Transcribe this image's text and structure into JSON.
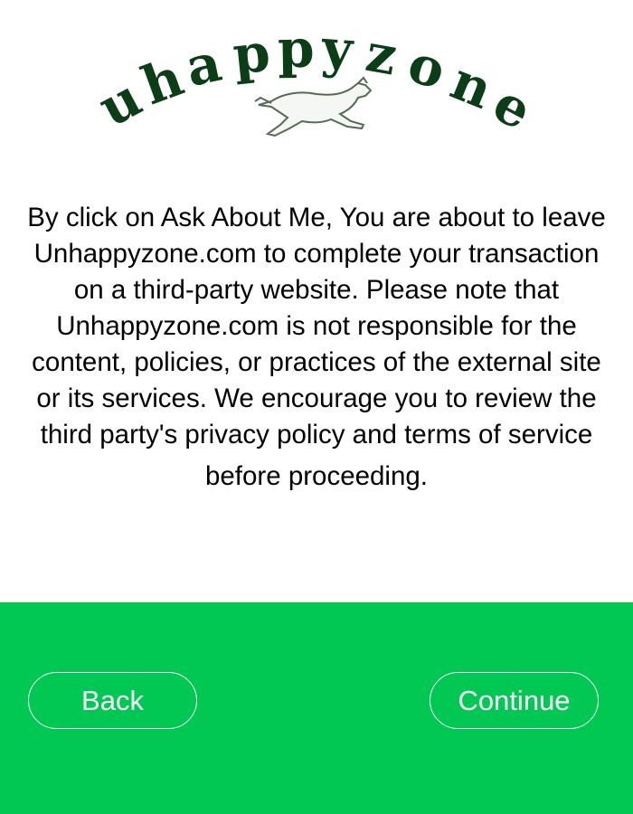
{
  "logo": {
    "text": "uhappyzone",
    "icon": "running-dog-icon",
    "text_color": "#0b3d16"
  },
  "notice": {
    "body": "By click on Ask About Me, You are about to leave Unhappyzone.com to complete your transaction on a third-party website. Please note that Unhappyzone.com is not responsible for the content, policies, or practices of the external site or its services. We encourage you to review the third party's privacy policy and terms of service",
    "last_line": "before proceeding."
  },
  "footer": {
    "background_color": "#00c853",
    "back_label": "Back",
    "continue_label": "Continue"
  }
}
